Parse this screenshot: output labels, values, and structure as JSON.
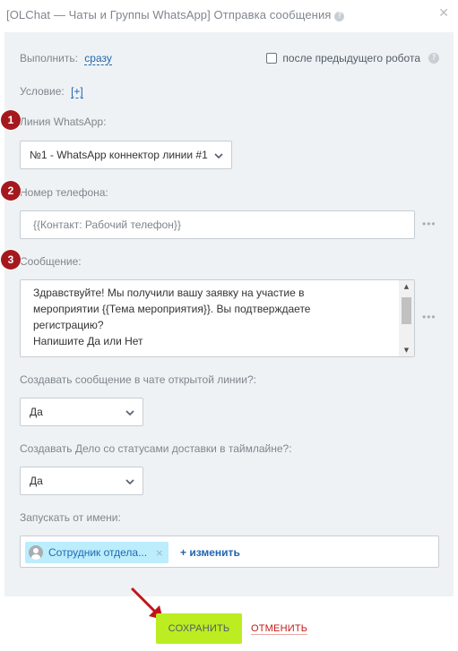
{
  "header": {
    "title": "[OLChat — Чаты и Группы WhatsApp] Отправка сообщения",
    "help_glyph": "?",
    "close_glyph": "✕"
  },
  "execute": {
    "label": "Выполнить:",
    "value": "сразу"
  },
  "after_robot": {
    "label": "после предыдущего робота",
    "checked": false
  },
  "condition": {
    "label": "Условие:",
    "link": "[+]"
  },
  "line": {
    "badge": "1",
    "label": "Линия WhatsApp:",
    "selected": "№1 - WhatsApp коннектор линии #1"
  },
  "phone": {
    "badge": "2",
    "label": "Номер телефона:",
    "value": "{{Контакт: Рабочий телефон}}",
    "more": "•••"
  },
  "message": {
    "badge": "3",
    "label": "Сообщение:",
    "lines": [
      "Здравствуйте! Мы получили вашу заявку на участие в",
      "мероприятии {{Тема мероприятия}}. Вы подтверждаете",
      "регистрацию?",
      "Напишите Да или Нет"
    ],
    "more": "•••"
  },
  "create_in_chat": {
    "label": "Создавать сообщение в чате открытой линии?:",
    "selected": "Да"
  },
  "create_deal": {
    "label": "Создавать Дело со статусами доставки в таймлайне?:",
    "selected": "Да"
  },
  "run_as": {
    "label": "Запускать от имени:",
    "user": "Сотрудник отдела...",
    "remove_glyph": "×",
    "change": "+ изменить"
  },
  "footer": {
    "save": "СОХРАНИТЬ",
    "cancel": "ОТМЕНИТЬ"
  },
  "colors": {
    "panel_bg": "#eef2f4",
    "badge": "#a5191e",
    "save_button": "#bbed21",
    "link": "#2067b0",
    "cancel": "#c21b16",
    "annotation_arrow": "#c0141b"
  }
}
